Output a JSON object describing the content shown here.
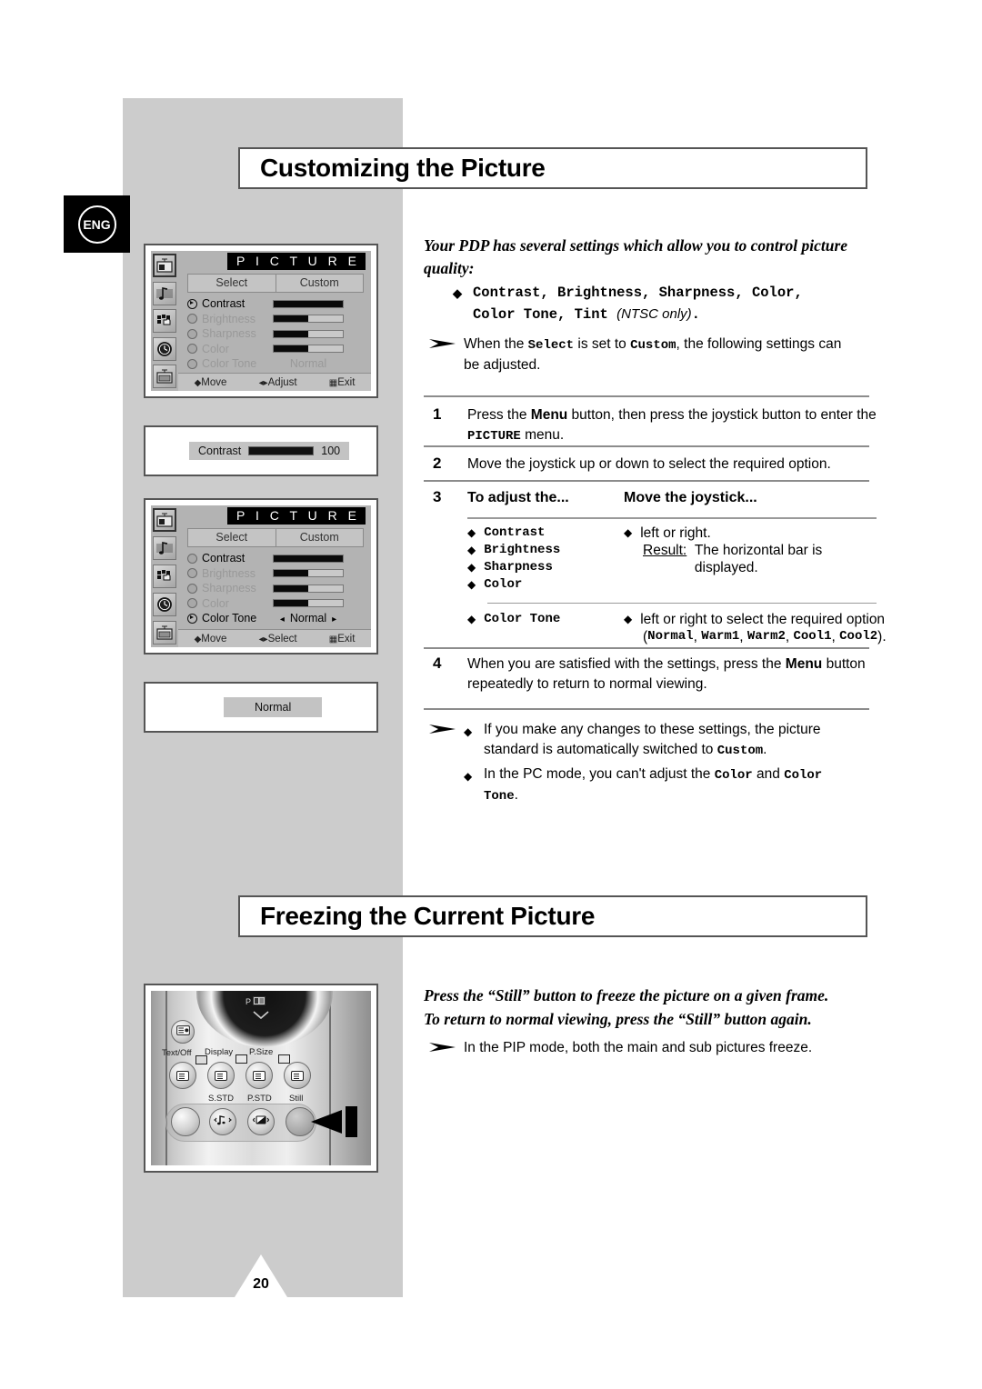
{
  "page": {
    "language_badge": "ENG",
    "page_number": "20"
  },
  "sections": {
    "customizing": {
      "title": "Customizing the Picture"
    },
    "freezing": {
      "title": "Freezing the Current Picture"
    }
  },
  "osd_menu_1": {
    "header": "P I C T U R E",
    "select_label": "Select",
    "select_value": "Custom",
    "items": [
      {
        "label": "Contrast",
        "type": "bar",
        "fill": 100,
        "selected": true
      },
      {
        "label": "Brightness",
        "type": "bar",
        "fill": 50,
        "selected": false
      },
      {
        "label": "Sharpness",
        "type": "bar",
        "fill": 50,
        "selected": false
      },
      {
        "label": "Color",
        "type": "bar",
        "fill": 50,
        "selected": false
      },
      {
        "label": "Color Tone",
        "type": "value",
        "value": "Normal",
        "selected": false
      }
    ],
    "footer": {
      "move": "Move",
      "middle": "Adjust",
      "exit": "Exit"
    },
    "sidebar_icons": [
      "picture-icon",
      "sound-icon",
      "setup-icon",
      "time-icon",
      "pip-icon"
    ]
  },
  "osd_menu_2": {
    "header": "P I C T U R E",
    "select_label": "Select",
    "select_value": "Custom",
    "items": [
      {
        "label": "Contrast",
        "type": "bar",
        "fill": 100,
        "selected": false
      },
      {
        "label": "Brightness",
        "type": "bar",
        "fill": 50,
        "selected": false
      },
      {
        "label": "Sharpness",
        "type": "bar",
        "fill": 50,
        "selected": false
      },
      {
        "label": "Color",
        "type": "bar",
        "fill": 50,
        "selected": false
      },
      {
        "label": "Color Tone",
        "type": "value",
        "value": "Normal",
        "selected": true,
        "arrows": true
      }
    ],
    "footer": {
      "move": "Move",
      "middle": "Select",
      "exit": "Exit"
    }
  },
  "osd_contrast_bar": {
    "label": "Contrast",
    "value": "100",
    "fill": 100
  },
  "osd_normal_box": {
    "value": "Normal"
  },
  "right_column": {
    "intro": "Your PDP has several settings which allow you to control picture quality:",
    "feature_bullet_line1": "Contrast, Brightness, Sharpness, Color,",
    "feature_bullet_line2_mono": "Color Tone, Tint",
    "feature_bullet_line2_italic": "(NTSC only)",
    "note1_pre": "When the ",
    "note1_select": "Select",
    "note1_mid": " is set to ",
    "note1_custom": "Custom",
    "note1_post": ", the following settings can be adjusted.",
    "steps": [
      {
        "num": "1",
        "pre": "Press the ",
        "bold1": "Menu",
        "mid": " button, then press the joystick button to enter the ",
        "mono1": "PICTURE",
        "post": " menu."
      },
      {
        "num": "2",
        "text": "Move the joystick up or down to select the required option."
      }
    ],
    "step3": {
      "num": "3",
      "col1_header": "To adjust the...",
      "col2_header": "Move the joystick...",
      "group1_items": [
        "Contrast",
        "Brightness",
        "Sharpness",
        "Color"
      ],
      "group1_action": "left or right.",
      "group1_result_label": "Result:",
      "group1_result_text": "The horizontal bar is displayed.",
      "group2_item": "Color Tone",
      "group2_action": "left or right to select the required option",
      "group2_options_open": "(",
      "group2_options": [
        "Normal",
        "Warm1",
        "Warm2",
        "Cool1",
        "Cool2"
      ],
      "group2_options_close": ")."
    },
    "step4": {
      "num": "4",
      "pre": "When you are satisfied with the settings, press the ",
      "bold1": "Menu",
      "post": " button repeatedly to return to normal viewing."
    },
    "note2": {
      "bullet1_pre": "If you make any changes to these settings, the picture standard is automatically switched to ",
      "bullet1_mono": "Custom",
      "bullet1_post": ".",
      "bullet2_pre": "In the PC mode, you can't adjust the ",
      "bullet2_mono1": "Color",
      "bullet2_mid": " and ",
      "bullet2_mono2": "Color Tone",
      "bullet2_post": "."
    },
    "freeze_intro_line1": "Press the “Still” button to freeze the picture on a given frame.",
    "freeze_intro_line2": "To return to normal viewing, press the “Still” button again.",
    "note3": "In the PIP mode, both the main and sub pictures freeze."
  },
  "remote": {
    "p_label": "P",
    "labels": {
      "text_off": "Text/Off",
      "display": "Display",
      "p_size": "P.Size",
      "s_std": "S.STD",
      "p_std": "P.STD",
      "still": "Still"
    }
  },
  "colors": {
    "band_gray": "#cccccc",
    "osd_gray": "#b3b3b3",
    "osd_header_bg": "#000000",
    "rule": "#8c8c8c"
  }
}
